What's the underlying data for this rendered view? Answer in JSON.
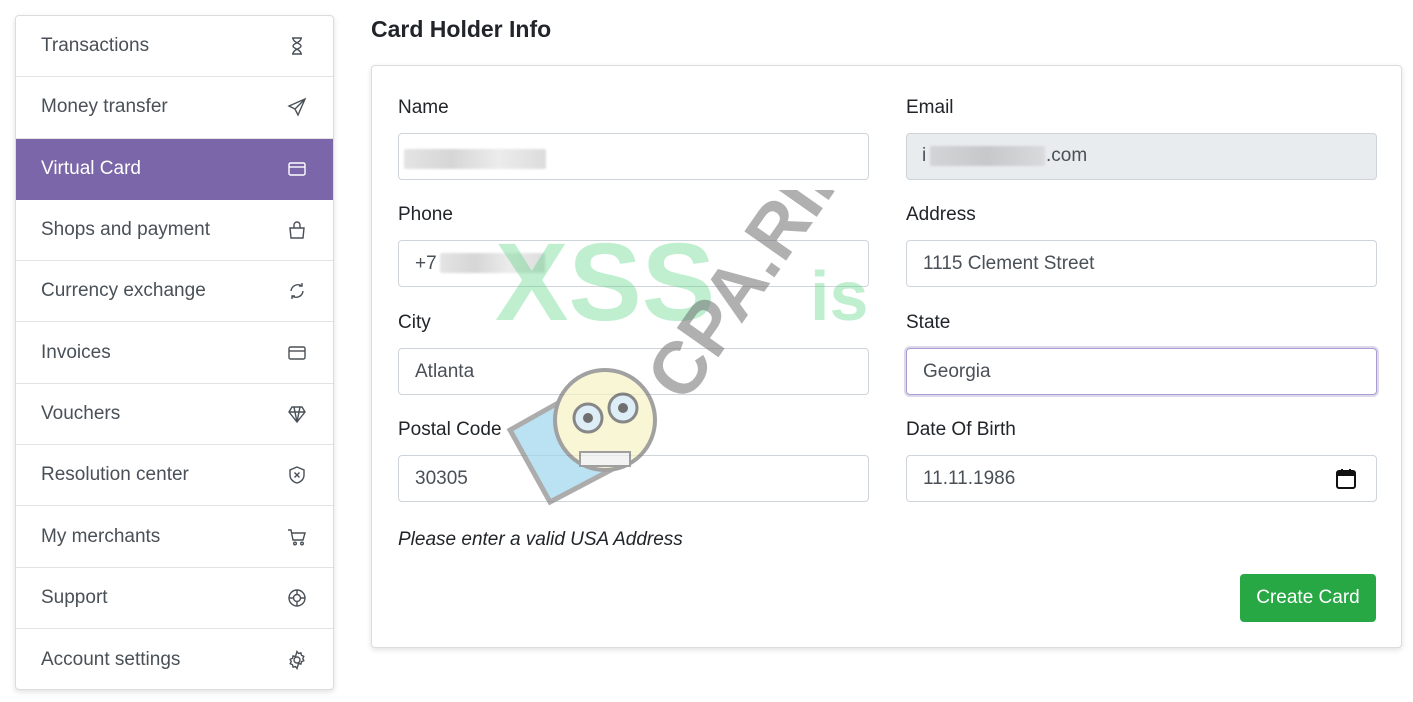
{
  "sidebar": {
    "items": [
      {
        "label": "Transactions",
        "icon": "hourglass-icon",
        "active": false
      },
      {
        "label": "Money transfer",
        "icon": "send-icon",
        "active": false
      },
      {
        "label": "Virtual Card",
        "icon": "credit-card-icon",
        "active": true
      },
      {
        "label": "Shops and payment",
        "icon": "shopping-bag-icon",
        "active": false
      },
      {
        "label": "Currency exchange",
        "icon": "refresh-icon",
        "active": false
      },
      {
        "label": "Invoices",
        "icon": "credit-card-icon",
        "active": false
      },
      {
        "label": "Vouchers",
        "icon": "diamond-icon",
        "active": false
      },
      {
        "label": "Resolution center",
        "icon": "shield-x-icon",
        "active": false
      },
      {
        "label": "My merchants",
        "icon": "cart-icon",
        "active": false
      },
      {
        "label": "Support",
        "icon": "lifebuoy-icon",
        "active": false
      },
      {
        "label": "Account settings",
        "icon": "gear-icon",
        "active": false
      }
    ],
    "active_color": "#7a66a8"
  },
  "main": {
    "title": "Card Holder Info",
    "form": {
      "name": {
        "label": "Name",
        "value": ""
      },
      "email": {
        "label": "Email",
        "value_start": "i",
        "value_end": ".com"
      },
      "phone": {
        "label": "Phone",
        "value": "+7"
      },
      "address": {
        "label": "Address",
        "value": "1115 Clement Street"
      },
      "city": {
        "label": "City",
        "value": "Atlanta"
      },
      "state": {
        "label": "State",
        "value": "Georgia"
      },
      "postal_code": {
        "label": "Postal Code",
        "value": "30305"
      },
      "dob": {
        "label": "Date Of Birth",
        "value": "11.11.1986"
      }
    },
    "note": "Please enter a valid USA Address",
    "submit_label": "Create Card",
    "submit_color": "#28a745"
  },
  "watermark": {
    "text1": "XSS",
    "text2": "CPA.RIP",
    "text3": "is"
  }
}
